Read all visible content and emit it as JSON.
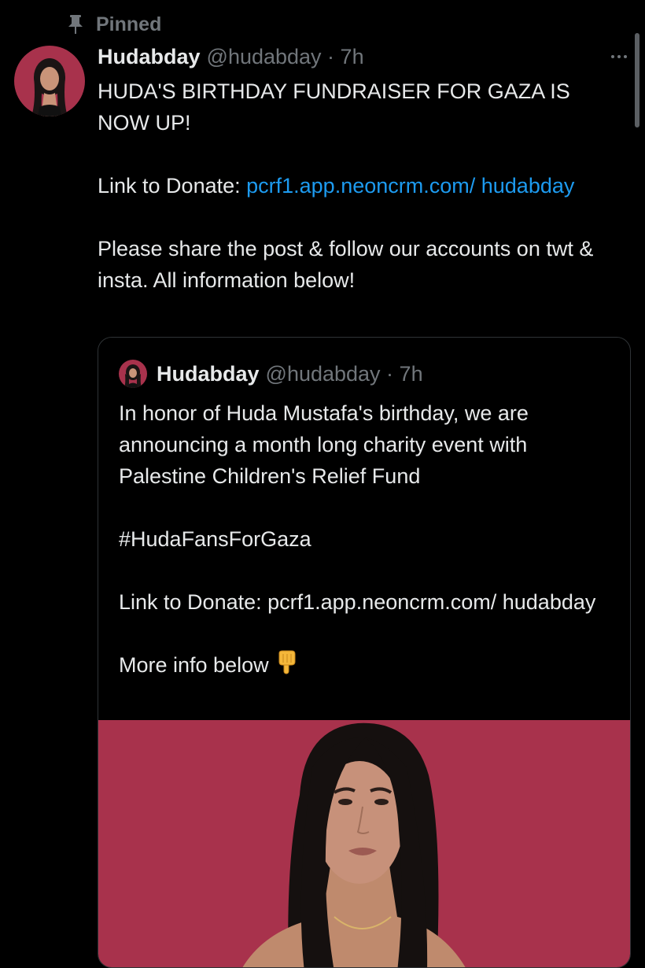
{
  "pinned": {
    "label": "Pinned",
    "icon": "pin-icon"
  },
  "post": {
    "display_name": "Hudabday",
    "handle_time": "@hudabday · 7h",
    "text_line1": "HUDA'S BIRTHDAY FUNDRAISER FOR GAZA IS NOW UP!",
    "donate_prefix": "Link to Donate: ",
    "donate_link": "pcrf1.app.neoncrm.com/ hudabday",
    "share_text": "Please share the post & follow our accounts on twt & insta. All information below!",
    "more_icon": "more-horizontal-icon"
  },
  "quote": {
    "display_name": "Hudabday",
    "handle_time": "@hudabday · 7h",
    "text_intro": "In honor of Huda Mustafa's birthday, we are announcing a month long charity event with Palestine Children's Relief Fund",
    "hashtag": "#HudaFansForGaza",
    "donate_text": "Link to Donate: pcrf1.app.neoncrm.com/ hudabday",
    "more_info": "More info below",
    "emoji": "backhand-index-pointing-down-icon"
  },
  "colors": {
    "background": "#000000",
    "text": "#e7e9ea",
    "muted": "#71767b",
    "link": "#1d9bf0",
    "border": "#2f3336",
    "photo_backdrop": "#a8324c"
  }
}
